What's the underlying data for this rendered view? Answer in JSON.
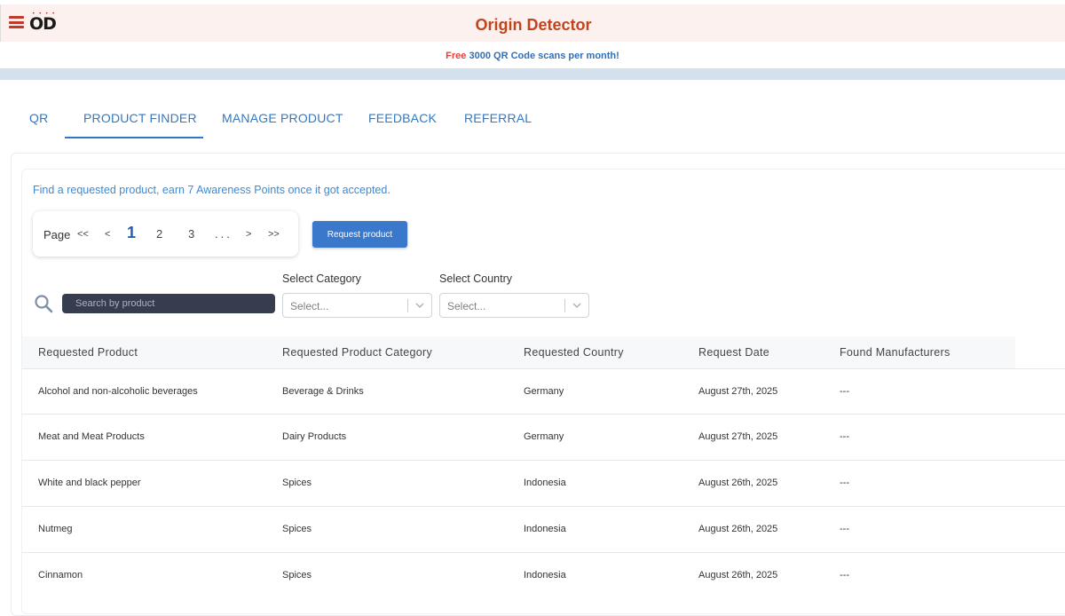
{
  "brand": {
    "logo_text": "OD",
    "logo_dots": "• • • •",
    "title": "Origin Detector"
  },
  "promo": {
    "free": "Free",
    "rest": "3000 QR Code scans per month!"
  },
  "tabs": [
    {
      "label": "QR",
      "active": false
    },
    {
      "label": "PRODUCT FINDER",
      "active": true
    },
    {
      "label": "MANAGE PRODUCT",
      "active": false
    },
    {
      "label": "FEEDBACK",
      "active": false
    },
    {
      "label": "REFERRAL",
      "active": false
    }
  ],
  "info_text": "Find a requested product, earn 7 Awareness Points once it got accepted.",
  "pagination": {
    "label": "Page",
    "first": "<<",
    "prev": "<",
    "pages": [
      "1",
      "2",
      "3"
    ],
    "current": "1",
    "ellipsis": "...",
    "next": ">",
    "last": ">>"
  },
  "request_button": "Request product",
  "search": {
    "placeholder": "Search by product"
  },
  "filters": {
    "category": {
      "label": "Select Category",
      "placeholder": "Select..."
    },
    "country": {
      "label": "Select Country",
      "placeholder": "Select..."
    }
  },
  "table": {
    "columns": [
      "Requested Product",
      "Requested Product Category",
      "Requested Country",
      "Request Date",
      "Found Manufacturers"
    ],
    "rows": [
      [
        "Alcohol and non-alcoholic beverages",
        "Beverage & Drinks",
        "Germany",
        "August 27th, 2025",
        "---"
      ],
      [
        "Meat and Meat Products",
        "Dairy Products",
        "Germany",
        "August 27th, 2025",
        "---"
      ],
      [
        "White and black pepper",
        "Spices",
        "Indonesia",
        "August 26th, 2025",
        "---"
      ],
      [
        "Nutmeg",
        "Spices",
        "Indonesia",
        "August 26th, 2025",
        "---"
      ],
      [
        "Cinnamon",
        "Spices",
        "Indonesia",
        "August 26th, 2025",
        "---"
      ]
    ]
  },
  "colors": {
    "brand_red": "#c1441d",
    "link_blue": "#2f79c7",
    "button_blue": "#3a78cc",
    "header_bg": "#fdf1ef"
  }
}
